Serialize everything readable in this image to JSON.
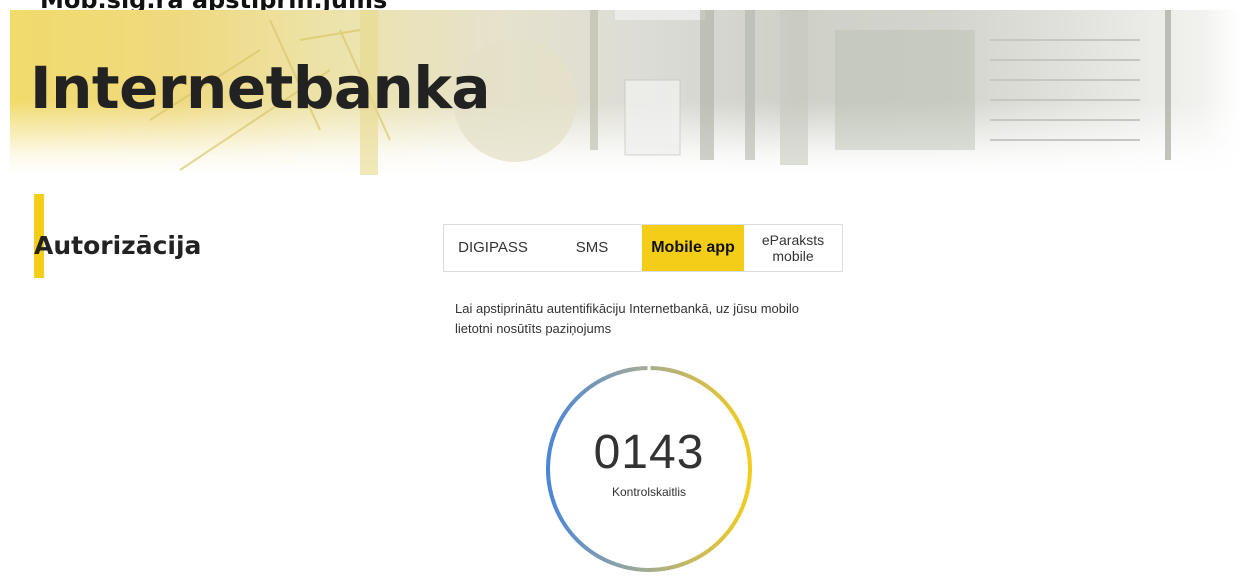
{
  "page": {
    "top_caption": "Mob.sig.ra apstiprin.jums",
    "hero_title": "Internetbanka",
    "section_title": "Autorizācija"
  },
  "auth_tabs": {
    "items": [
      {
        "label": "DIGIPASS",
        "active": false
      },
      {
        "label": "SMS",
        "active": false
      },
      {
        "label": "Mobile app",
        "active": true
      },
      {
        "label": "eParaksts\nmobile",
        "active": false
      }
    ]
  },
  "info": {
    "text": "Lai apstiprinātu autentifikāciju Internetbankā, uz jūsu mobilo lietotni nosūtīts paziņojums"
  },
  "verification": {
    "code": "0143",
    "label": "Kontrolskaitlis"
  },
  "colors": {
    "accent_yellow": "#f3cd18",
    "ring_blue": "#4a86d8",
    "ring_yellow": "#f2cd1f",
    "ring_gray": "#9fa89a"
  }
}
